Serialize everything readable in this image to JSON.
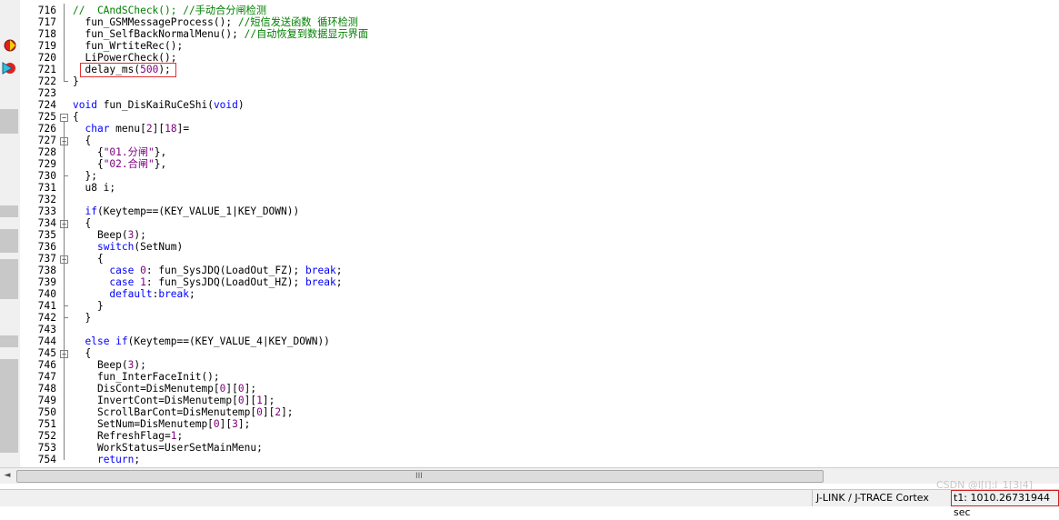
{
  "editor": {
    "lines": [
      {
        "n": "716",
        "code": [
          [
            "cm",
            "//  CAndSCheck(); //手动合分闸检测"
          ]
        ]
      },
      {
        "n": "717",
        "code": [
          [
            "",
            "  fun_GSMMessageProcess(); "
          ],
          [
            "cm",
            "//短信发送函数 循环检测"
          ]
        ]
      },
      {
        "n": "718",
        "code": [
          [
            "",
            "  fun_SelfBackNormalMenu(); "
          ],
          [
            "cm",
            "//自动恢复到数据显示界面"
          ]
        ]
      },
      {
        "n": "719",
        "code": [
          [
            "",
            "  fun_WrtiteRec();"
          ]
        ]
      },
      {
        "n": "720",
        "code": [
          [
            "",
            "  LiPowerCheck();"
          ]
        ]
      },
      {
        "n": "721",
        "code": [
          [
            "",
            "  delay_ms("
          ],
          [
            "num",
            "500"
          ],
          [
            "",
            ");"
          ]
        ]
      },
      {
        "n": "722",
        "code": [
          [
            "",
            "}"
          ]
        ]
      },
      {
        "n": "723",
        "code": [
          [
            "",
            ""
          ]
        ]
      },
      {
        "n": "724",
        "code": [
          [
            "kw",
            "void"
          ],
          [
            "",
            " fun_DisKaiRuCeShi("
          ],
          [
            "kw",
            "void"
          ],
          [
            "",
            ")"
          ]
        ]
      },
      {
        "n": "725",
        "code": [
          [
            "",
            "{"
          ]
        ]
      },
      {
        "n": "726",
        "code": [
          [
            "",
            "  "
          ],
          [
            "kw",
            "char"
          ],
          [
            "",
            " menu["
          ],
          [
            "num",
            "2"
          ],
          [
            "",
            "]["
          ],
          [
            "num",
            "18"
          ],
          [
            "",
            "]="
          ]
        ]
      },
      {
        "n": "727",
        "code": [
          [
            "",
            "  {"
          ]
        ]
      },
      {
        "n": "728",
        "code": [
          [
            "",
            "    {"
          ],
          [
            "str",
            "\"01.分闸\""
          ],
          [
            "",
            "},"
          ]
        ]
      },
      {
        "n": "729",
        "code": [
          [
            "",
            "    {"
          ],
          [
            "str",
            "\"02.合闸\""
          ],
          [
            "",
            "},"
          ]
        ]
      },
      {
        "n": "730",
        "code": [
          [
            "",
            "  };"
          ]
        ]
      },
      {
        "n": "731",
        "code": [
          [
            "",
            "  u8 i;"
          ]
        ]
      },
      {
        "n": "732",
        "code": [
          [
            "",
            ""
          ]
        ]
      },
      {
        "n": "733",
        "code": [
          [
            "",
            "  "
          ],
          [
            "kw",
            "if"
          ],
          [
            "",
            "(Keytemp==(KEY_VALUE_1|KEY_DOWN))"
          ]
        ]
      },
      {
        "n": "734",
        "code": [
          [
            "",
            "  {"
          ]
        ]
      },
      {
        "n": "735",
        "code": [
          [
            "",
            "    Beep("
          ],
          [
            "num",
            "3"
          ],
          [
            "",
            ");"
          ]
        ]
      },
      {
        "n": "736",
        "code": [
          [
            "",
            "    "
          ],
          [
            "kw",
            "switch"
          ],
          [
            "",
            "(SetNum)"
          ]
        ]
      },
      {
        "n": "737",
        "code": [
          [
            "",
            "    {"
          ]
        ]
      },
      {
        "n": "738",
        "code": [
          [
            "",
            "      "
          ],
          [
            "kw",
            "case"
          ],
          [
            "",
            " "
          ],
          [
            "num",
            "0"
          ],
          [
            "",
            ": fun_SysJDQ(LoadOut_FZ); "
          ],
          [
            "kw",
            "break"
          ],
          [
            "",
            ";"
          ]
        ]
      },
      {
        "n": "739",
        "code": [
          [
            "",
            "      "
          ],
          [
            "kw",
            "case"
          ],
          [
            "",
            " "
          ],
          [
            "num",
            "1"
          ],
          [
            "",
            ": fun_SysJDQ(LoadOut_HZ); "
          ],
          [
            "kw",
            "break"
          ],
          [
            "",
            ";"
          ]
        ]
      },
      {
        "n": "740",
        "code": [
          [
            "",
            "      "
          ],
          [
            "kw",
            "default"
          ],
          [
            "",
            ":"
          ],
          [
            "kw",
            "break"
          ],
          [
            "",
            ";"
          ]
        ]
      },
      {
        "n": "741",
        "code": [
          [
            "",
            "    }"
          ]
        ]
      },
      {
        "n": "742",
        "code": [
          [
            "",
            "  }"
          ]
        ]
      },
      {
        "n": "743",
        "code": [
          [
            "",
            ""
          ]
        ]
      },
      {
        "n": "744",
        "code": [
          [
            "",
            "  "
          ],
          [
            "kw",
            "else if"
          ],
          [
            "",
            "(Keytemp==(KEY_VALUE_4|KEY_DOWN))"
          ]
        ]
      },
      {
        "n": "745",
        "code": [
          [
            "",
            "  {"
          ]
        ]
      },
      {
        "n": "746",
        "code": [
          [
            "",
            "    Beep("
          ],
          [
            "num",
            "3"
          ],
          [
            "",
            ");"
          ]
        ]
      },
      {
        "n": "747",
        "code": [
          [
            "",
            "    fun_InterFaceInit();"
          ]
        ]
      },
      {
        "n": "748",
        "code": [
          [
            "",
            "    DisCont=DisMenutemp["
          ],
          [
            "num",
            "0"
          ],
          [
            "",
            "]["
          ],
          [
            "num",
            "0"
          ],
          [
            "",
            "];"
          ]
        ]
      },
      {
        "n": "749",
        "code": [
          [
            "",
            "    InvertCont=DisMenutemp["
          ],
          [
            "num",
            "0"
          ],
          [
            "",
            "]["
          ],
          [
            "num",
            "1"
          ],
          [
            "",
            "];"
          ]
        ]
      },
      {
        "n": "750",
        "code": [
          [
            "",
            "    ScrollBarCont=DisMenutemp["
          ],
          [
            "num",
            "0"
          ],
          [
            "",
            "]["
          ],
          [
            "num",
            "2"
          ],
          [
            "",
            "];"
          ]
        ]
      },
      {
        "n": "751",
        "code": [
          [
            "",
            "    SetNum=DisMenutemp["
          ],
          [
            "num",
            "0"
          ],
          [
            "",
            "]["
          ],
          [
            "num",
            "3"
          ],
          [
            "",
            "];"
          ]
        ]
      },
      {
        "n": "752",
        "code": [
          [
            "",
            "    RefreshFlag="
          ],
          [
            "num",
            "1"
          ],
          [
            "",
            ";"
          ]
        ]
      },
      {
        "n": "753",
        "code": [
          [
            "",
            "    WorkStatus=UserSetMainMenu;"
          ]
        ]
      },
      {
        "n": "754",
        "code": [
          [
            "",
            "    "
          ],
          [
            "kw",
            "return"
          ],
          [
            "",
            ";"
          ]
        ]
      }
    ]
  },
  "status": {
    "target": "J-LINK / J-TRACE Cortex",
    "time": "t1: 1010.26731944 sec"
  },
  "scrollbar": {
    "grip": "III",
    "left_arrow": "◄"
  },
  "watermark": "CSDN @l[l]:l_1[3|4]",
  "colors": {
    "keyword": "#0000ff",
    "number": "#800080",
    "comment": "#008000",
    "highlight_box": "#e03030"
  }
}
